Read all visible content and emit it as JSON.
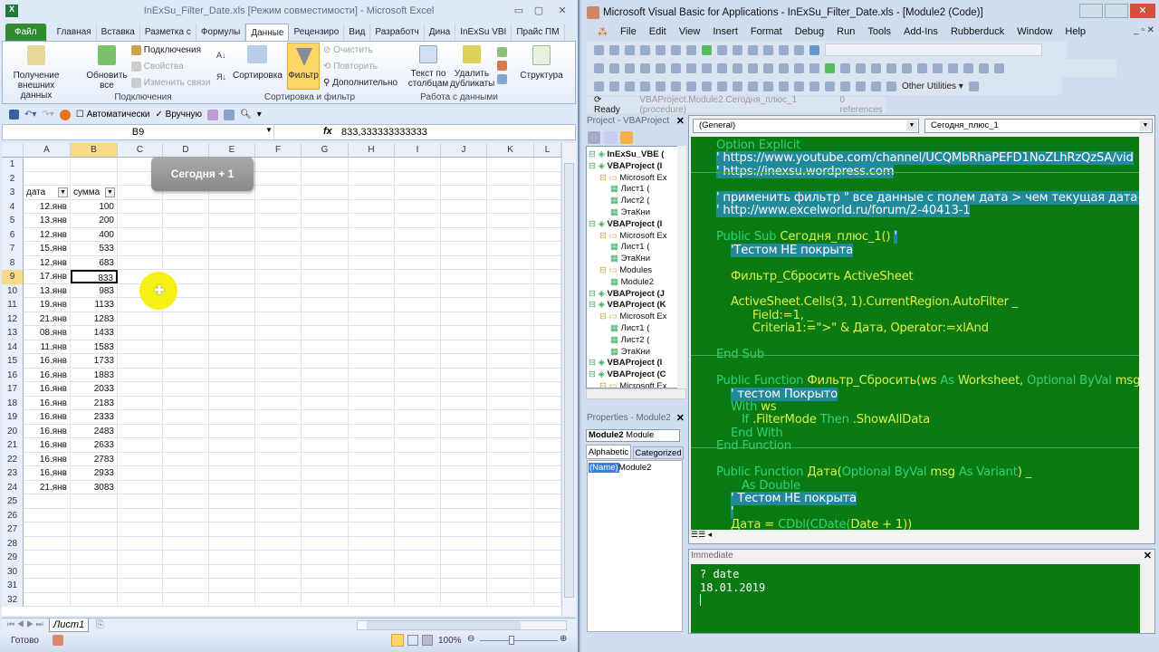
{
  "excel": {
    "title": "InExSu_Filter_Date.xls  [Режим совместимости]  -  Microsoft Excel",
    "tabs": [
      "Файл",
      "Главная",
      "Вставка",
      "Разметка с",
      "Формулы",
      "Данные",
      "Рецензиро",
      "Вид",
      "Разработч",
      "Дина",
      "InExSu VBI",
      "Прайс ПМ"
    ],
    "active_tab": "Данные",
    "ribbon": {
      "get_external": "Получение внешних данных",
      "refresh_all": "Обновить все",
      "connections": "Подключения",
      "properties": "Свойства",
      "edit_links": "Изменить связи",
      "group_connections": "Подключения",
      "sort": "Сортировка",
      "filter": "Фильтр",
      "clear": "Очистить",
      "reapply": "Повторить",
      "advanced": "Дополнительно",
      "group_sort": "Сортировка и фильтр",
      "text_to_columns": "Текст по столбцам",
      "remove_duplicates": "Удалить дубликаты",
      "group_data": "Работа с данными",
      "outline": "Структура"
    },
    "qat": {
      "auto": "Автоматически",
      "manual": "Вручную"
    },
    "formula_bar": {
      "name_box": "B9",
      "formula": "833,333333333333"
    },
    "columns": [
      "A",
      "B",
      "C",
      "D",
      "E",
      "F",
      "G",
      "H",
      "I",
      "J",
      "K",
      "L"
    ],
    "headers": [
      "дата",
      "сумма"
    ],
    "rows": [
      [
        "12.янв",
        "100"
      ],
      [
        "13.янв",
        "200"
      ],
      [
        "12.янв",
        "400"
      ],
      [
        "15.янв",
        "533"
      ],
      [
        "12.янв",
        "683"
      ],
      [
        "17.янв",
        "833"
      ],
      [
        "13.янв",
        "983"
      ],
      [
        "19.янв",
        "1133"
      ],
      [
        "21.янв",
        "1283"
      ],
      [
        "08.янв",
        "1433"
      ],
      [
        "11.янв",
        "1583"
      ],
      [
        "16.янв",
        "1733"
      ],
      [
        "16.янв",
        "1883"
      ],
      [
        "16.янв",
        "2033"
      ],
      [
        "16.янв",
        "2183"
      ],
      [
        "16.янв",
        "2333"
      ],
      [
        "16.янв",
        "2483"
      ],
      [
        "16.янв",
        "2633"
      ],
      [
        "16.янв",
        "2783"
      ],
      [
        "16.янв",
        "2933"
      ],
      [
        "21.янв",
        "3083"
      ]
    ],
    "row_count": 32,
    "selected_row": 9,
    "shape_button": "Сегодня + 1",
    "sheet_tab": "Лист1",
    "status": "Готово",
    "zoom": "100%"
  },
  "vba": {
    "title": "Microsoft Visual Basic for Applications - InExSu_Filter_Date.xls - [Module2 (Code)]",
    "menu": [
      "File",
      "Edit",
      "View",
      "Insert",
      "Format",
      "Debug",
      "Run",
      "Tools",
      "Add-Ins",
      "Rubberduck",
      "Window",
      "Help"
    ],
    "other_utilities": "Other Utilities",
    "ready": "Ready",
    "procedure": "VBAProject.Module2.Сегодня_плюс_1 (procedure)",
    "references": "0 references",
    "project_title": "Project - VBAProject",
    "tree": [
      {
        "l": 0,
        "t": "InExSu_VBE (",
        "b": true
      },
      {
        "l": 0,
        "t": "VBAProject (I",
        "b": true
      },
      {
        "l": 1,
        "t": "Microsoft Ex"
      },
      {
        "l": 2,
        "t": "Лист1 ("
      },
      {
        "l": 2,
        "t": "Лист2 ("
      },
      {
        "l": 2,
        "t": "ЭтаКни"
      },
      {
        "l": 0,
        "t": "VBAProject (I",
        "b": true
      },
      {
        "l": 1,
        "t": "Microsoft Ex"
      },
      {
        "l": 2,
        "t": "Лист1 ("
      },
      {
        "l": 2,
        "t": "ЭтаКни"
      },
      {
        "l": 1,
        "t": "Modules"
      },
      {
        "l": 2,
        "t": "Module2"
      },
      {
        "l": 0,
        "t": "VBAProject (J",
        "b": true
      },
      {
        "l": 0,
        "t": "VBAProject (K",
        "b": true
      },
      {
        "l": 1,
        "t": "Microsoft Ex"
      },
      {
        "l": 2,
        "t": "Лист1 ("
      },
      {
        "l": 2,
        "t": "Лист2 ("
      },
      {
        "l": 2,
        "t": "ЭтаКни"
      },
      {
        "l": 0,
        "t": "VBAProject (I",
        "b": true
      },
      {
        "l": 0,
        "t": "VBAProject (C",
        "b": true
      },
      {
        "l": 1,
        "t": "Microsoft Ex"
      }
    ],
    "props_title": "Properties - Module2",
    "props_object": "Module2",
    "props_type": "Module",
    "props_tabs": [
      "Alphabetic",
      "Categorized"
    ],
    "prop_name": "(Name)",
    "prop_value": "Module2",
    "combo_general": "(General)",
    "combo_proc": "Сегодня_плюс_1",
    "code": [
      [
        [
          "k",
          "Option Explicit"
        ]
      ],
      [
        [
          "c",
          "' https://www.youtube.com/channel/UCQMbRhaPEFD1NoZLhRzQzSA/vid"
        ]
      ],
      [
        [
          "c",
          "' https://inexsu.wordpress.com"
        ]
      ],
      [],
      [
        [
          "c",
          "' применить фильтр \" все данные с полем дата > чем текущая дата+1"
        ]
      ],
      [
        [
          "c",
          "' http://www.excelworld.ru/forum/2-40413-1"
        ]
      ],
      [],
      [
        [
          "k",
          "Public Sub "
        ],
        [
          "y",
          "Сегодня_плюс_1() "
        ],
        [
          "c",
          "'"
        ]
      ],
      [
        [
          "y",
          "    "
        ],
        [
          "c",
          "'Тестом НЕ покрыта"
        ]
      ],
      [],
      [
        [
          "y",
          "    Фильтр_Сбросить ActiveSheet"
        ]
      ],
      [],
      [
        [
          "y",
          "    ActiveSheet.Cells(3, 1).CurrentRegion.AutoFilter _"
        ]
      ],
      [
        [
          "y",
          "          Field:=1, _"
        ]
      ],
      [
        [
          "y",
          "          Criteria1:=\">\" & Дата, Operator:=xlAnd"
        ]
      ],
      [],
      [
        [
          "k",
          "End Sub"
        ]
      ],
      [],
      [
        [
          "k",
          "Public Function "
        ],
        [
          "y",
          "Фильтр_Сбросить(ws "
        ],
        [
          "k",
          "As "
        ],
        [
          "y",
          "Worksheet, "
        ],
        [
          "k",
          "Optional ByVal "
        ],
        [
          "y",
          "msg"
        ]
      ],
      [
        [
          "y",
          "    "
        ],
        [
          "c",
          "' тестом Покрыто"
        ]
      ],
      [
        [
          "k",
          "    With "
        ],
        [
          "y",
          "ws"
        ]
      ],
      [
        [
          "k",
          "       If "
        ],
        [
          "y",
          ".FilterMode "
        ],
        [
          "k",
          "Then "
        ],
        [
          "y",
          ".ShowAllData"
        ]
      ],
      [
        [
          "k",
          "    End With"
        ]
      ],
      [
        [
          "k",
          "End Function"
        ]
      ],
      [],
      [
        [
          "k",
          "Public Function "
        ],
        [
          "y",
          "Дата("
        ],
        [
          "k",
          "Optional ByVal "
        ],
        [
          "y",
          "msg "
        ],
        [
          "k",
          "As Variant"
        ],
        [
          "y",
          ") _"
        ]
      ],
      [
        [
          "k",
          "       As Double"
        ]
      ],
      [
        [
          "y",
          "    "
        ],
        [
          "c",
          "' Тестом НЕ покрыта"
        ]
      ],
      [
        [
          "y",
          "    "
        ],
        [
          "c",
          "'"
        ]
      ],
      [
        [
          "y",
          "    Дата = "
        ],
        [
          "k",
          "CDbl(CDate("
        ],
        [
          "y",
          "Date + 1))"
        ]
      ]
    ],
    "immediate_title": "Immediate",
    "immediate": [
      "? date",
      "18.01.2019"
    ]
  },
  "colors": {
    "code_bg": "#0a7a12",
    "keyword": "#35d07a",
    "identifier": "#dff04a",
    "comment_bg": "#20899a"
  }
}
